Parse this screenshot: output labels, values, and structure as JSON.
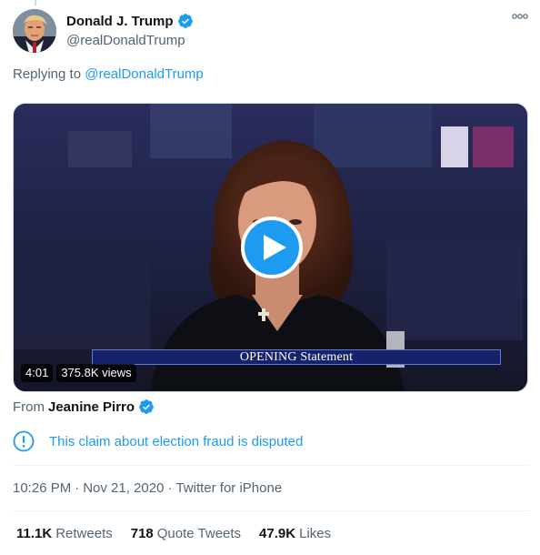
{
  "author": {
    "display_name": "Donald J. Trump",
    "handle": "@realDonaldTrump",
    "verified_icon": "verified-badge-icon",
    "avatar_icon": "avatar"
  },
  "more_icon": "more-icon",
  "reply": {
    "prefix": "Replying to",
    "mention": "@realDonaldTrump"
  },
  "video": {
    "lower_third_caps": "OPENING",
    "lower_third_rest": "Statement",
    "duration": "4:01",
    "views": "375.8K views",
    "play_icon": "play-icon"
  },
  "source": {
    "prefix": "From",
    "name": "Jeanine Pirro",
    "verified_icon": "verified-badge-icon"
  },
  "notice": {
    "text": "This claim about election fraud is disputed",
    "icon": "info-icon"
  },
  "meta": {
    "time": "10:26 PM",
    "date": "Nov 21, 2020",
    "client": "Twitter for iPhone"
  },
  "stats": {
    "retweets_count": "11.1K",
    "retweets_label": "Retweets",
    "quotes_count": "718",
    "quotes_label": "Quote Tweets",
    "likes_count": "47.9K",
    "likes_label": "Likes"
  },
  "colors": {
    "accent": "#1d9bf0",
    "text_primary": "#0f1419",
    "text_secondary": "#536471",
    "divider": "#eff3f4"
  }
}
